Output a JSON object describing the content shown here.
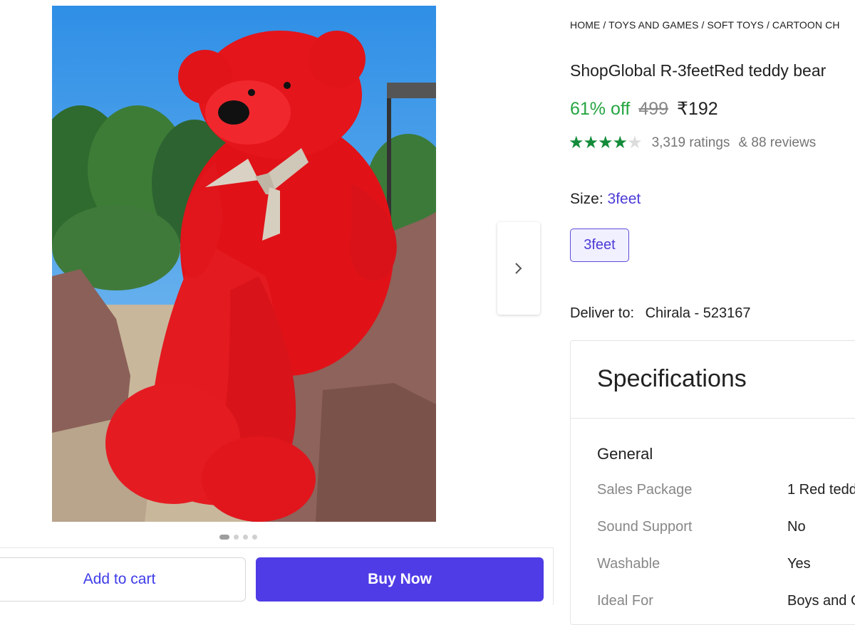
{
  "gallery": {
    "image_alt": "ShopGlobal R-3feetRed teddy bear",
    "dots_count": 4,
    "active_dot": 0,
    "next_icon": "chevron-right-icon"
  },
  "actions": {
    "add_to_cart_label": "Add to cart",
    "buy_now_label": "Buy Now"
  },
  "breadcrumb": "HOME / TOYS AND GAMES / SOFT TOYS / CARTOON CH",
  "product": {
    "title": "ShopGlobal R-3feetRed teddy bear",
    "discount": "61% off",
    "mrp": "499",
    "price": "₹192",
    "rating_stars": 4,
    "ratings_text": "3,319 ratings",
    "reviews_text": "& 88 reviews"
  },
  "size": {
    "label": "Size:",
    "selected": "3feet",
    "options": [
      "3feet"
    ]
  },
  "delivery": {
    "label": "Deliver to:",
    "location": "Chirala - 523167"
  },
  "specifications": {
    "title": "Specifications",
    "group": "General",
    "rows": [
      {
        "key": "Sales Package",
        "value": "1 Red tedd"
      },
      {
        "key": "Sound Support",
        "value": "No"
      },
      {
        "key": "Washable",
        "value": "Yes"
      },
      {
        "key": "Ideal For",
        "value": "Boys and G"
      }
    ]
  },
  "colors": {
    "accent": "#4f3ce6",
    "discount_green": "#26a541",
    "star_green": "#138b3a"
  }
}
